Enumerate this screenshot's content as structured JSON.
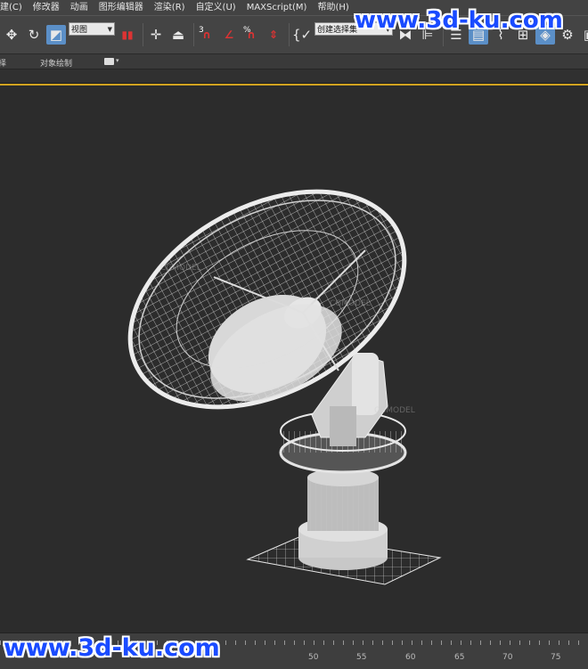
{
  "menu": {
    "items": [
      "建(C)",
      "修改器",
      "动画",
      "图形编辑器",
      "渲染(R)",
      "自定义(U)",
      "MAXScript(M)",
      "帮助(H)"
    ]
  },
  "toolbar": {
    "view_dropdown": "视图",
    "named_selection": "创建选择集",
    "snap_3": "3",
    "percent_snap": "%"
  },
  "ribbon": {
    "tab_1": "择",
    "tab_2": "对象绘制"
  },
  "timeline": {
    "labels": [
      "50",
      "55",
      "60",
      "65",
      "70",
      "75"
    ]
  },
  "watermark": {
    "site": "www.3d-ku.com"
  },
  "icons": [
    "move-icon",
    "rotate-icon",
    "scale-icon",
    "mirror-icon",
    "align-icon",
    "layer-icon",
    "render-setup-icon",
    "render-icon"
  ]
}
